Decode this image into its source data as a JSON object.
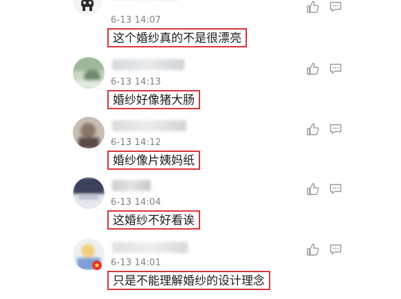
{
  "comments": [
    {
      "time": "6-13 14:07",
      "text": "这个婚纱真的不是很漂亮"
    },
    {
      "time": "6-13 14:13",
      "text": "婚纱好像猪大肠"
    },
    {
      "time": "6-13 14:12",
      "text": "婚纱像片姨妈纸"
    },
    {
      "time": "6-13 14:04",
      "text": "这婚纱不好看诶"
    },
    {
      "time": "6-13 14:01",
      "text": "只是不能理解婚纱的设计理念"
    }
  ],
  "icons": {
    "like": "thumbs-up-icon",
    "reply": "comment-icon",
    "badge": "verified-badge-icon"
  },
  "colors": {
    "highlight_border": "#d8333a",
    "timestamp": "#7f7f7f",
    "icon_gray": "#9a9a9a",
    "badge_red": "#e6352b"
  }
}
